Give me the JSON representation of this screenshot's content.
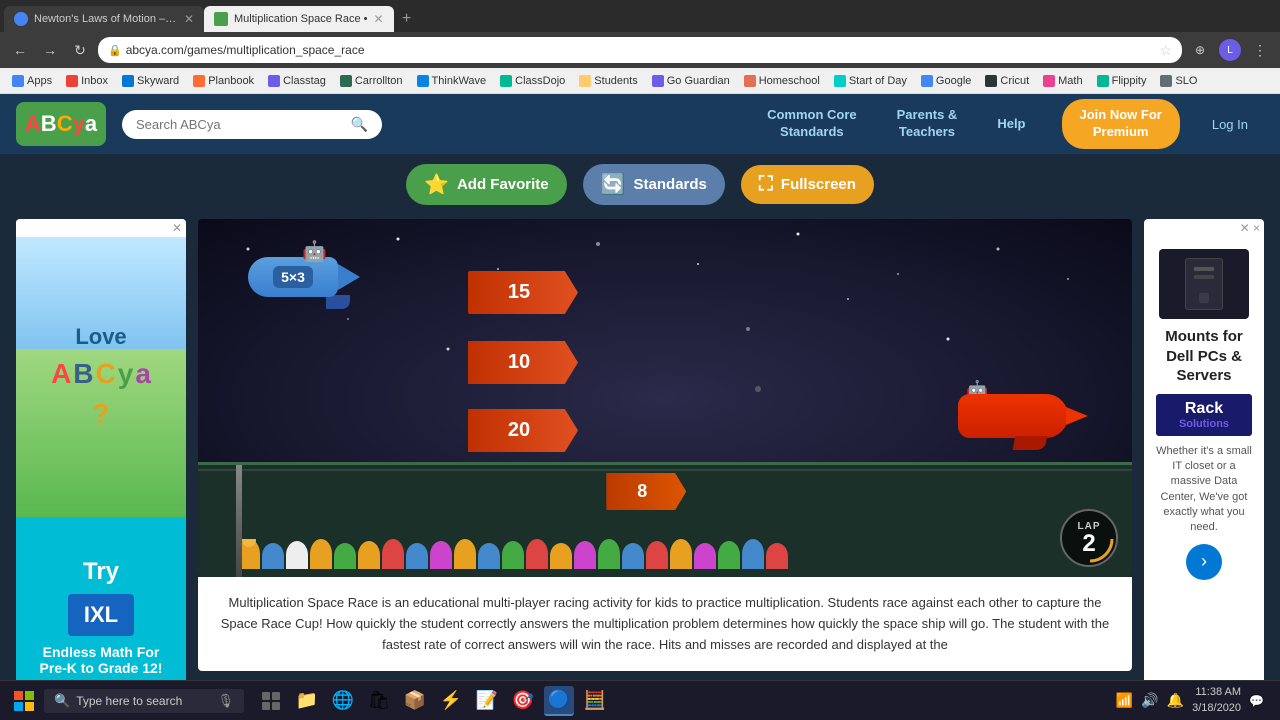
{
  "browser": {
    "tabs": [
      {
        "label": "Newton's Laws of Motion – Sto...",
        "active": false,
        "favicon_color": "#4285f4"
      },
      {
        "label": "Multiplication Space Race •",
        "active": true,
        "favicon_color": "#4a9f4a"
      }
    ],
    "new_tab_label": "+",
    "address": "abcya.com/games/multiplication_space_race"
  },
  "bookmarks": [
    {
      "label": "Apps",
      "color": "#4285f4"
    },
    {
      "label": "Inbox",
      "color": "#ea4335"
    },
    {
      "label": "Skyward",
      "color": "#0078d4"
    },
    {
      "label": "Planbook",
      "color": "#ff6b35"
    },
    {
      "label": "Classtag",
      "color": "#6c5ce7"
    },
    {
      "label": "Carrollton",
      "color": "#2d6a4f"
    },
    {
      "label": "ThinkWave",
      "color": "#0984e3"
    },
    {
      "label": "ClassDojo",
      "color": "#00b894"
    },
    {
      "label": "Students",
      "color": "#fdcb6e"
    },
    {
      "label": "Go Guardian",
      "color": "#6c5ce7"
    },
    {
      "label": "Homeschool",
      "color": "#e17055"
    },
    {
      "label": "Start of Day",
      "color": "#00cec9"
    },
    {
      "label": "Google",
      "color": "#4285f4"
    },
    {
      "label": "Cricut",
      "color": "#2d3436"
    },
    {
      "label": "Math",
      "color": "#e84393"
    },
    {
      "label": "Flippity",
      "color": "#00b894"
    },
    {
      "label": "SLO",
      "color": "#636e72"
    }
  ],
  "nav": {
    "logo_text": "ABCya",
    "search_placeholder": "Search ABCya",
    "links": [
      "Common Core Standards",
      "Parents & Teachers",
      "Help"
    ],
    "join_label": "Join Now For Premium",
    "login_label": "Log In"
  },
  "toolbar": {
    "favorite_label": "Add Favorite",
    "standards_label": "Standards",
    "fullscreen_label": "Fullscreen"
  },
  "game": {
    "title": "Multiplication Space Race",
    "math_problem": "5×3",
    "answers": [
      "15",
      "10",
      "20"
    ],
    "track_answer": "8",
    "lap_label": "LAP",
    "lap_number": "2"
  },
  "ads": {
    "left": {
      "love_text": "Love",
      "try_text": "Try",
      "ixl_label": "IXL",
      "ixl_subtext": "Endless Math For Pre-K to Grade 12!"
    },
    "right": {
      "title": "Mounts for Dell PCs & Servers",
      "rack_label": "Rack",
      "rack_sub": "Solutions",
      "description": "Whether it's a small IT closet or a massive Data Center, We've got exactly what you need.",
      "cta": "›"
    }
  },
  "description": "Multiplication Space Race is an educational multi-player racing activity for kids to practice multiplication. Students race against each other to capture the Space Race Cup! How quickly the student correctly answers the multiplication problem determines how quickly the space ship will go. The student with the fastest rate of correct answers will win the race. Hits and misses are recorded and displayed at the",
  "taskbar": {
    "search_placeholder": "Type here to search",
    "time": "11:38 AM",
    "date": "3/18/2020"
  }
}
